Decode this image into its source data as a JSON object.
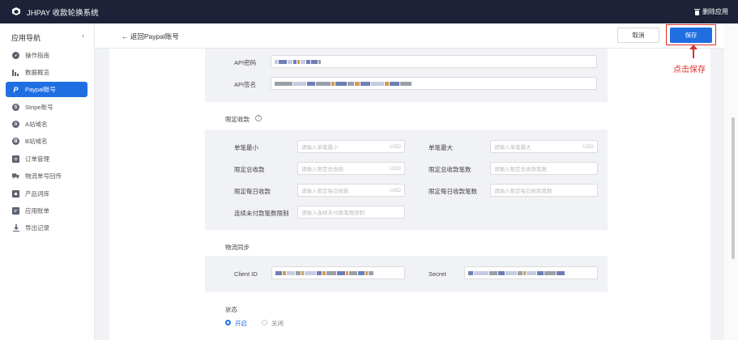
{
  "topbar": {
    "title": "JHPAY 收款轮换系统",
    "delete_app": "删除应用"
  },
  "sidebar": {
    "title": "应用导航",
    "collapse": "‹",
    "items": [
      {
        "label": "操作指南",
        "icon": "compass-icon"
      },
      {
        "label": "数据概览",
        "icon": "bar-chart-icon"
      },
      {
        "label": "Paypal账号",
        "icon": "paypal-icon",
        "active": true
      },
      {
        "label": "Stripe账号",
        "icon": "stripe-icon"
      },
      {
        "label": "A站域名",
        "icon": "a-site-icon"
      },
      {
        "label": "B站域名",
        "icon": "b-site-icon"
      },
      {
        "label": "订单管理",
        "icon": "order-icon"
      },
      {
        "label": "物流单号回传",
        "icon": "truck-icon"
      },
      {
        "label": "产品词库",
        "icon": "book-icon"
      },
      {
        "label": "应用账单",
        "icon": "bill-icon"
      },
      {
        "label": "导出记录",
        "icon": "download-icon"
      }
    ]
  },
  "header": {
    "back": "← 返回Paypal账号",
    "cancel": "取消",
    "save": "保存"
  },
  "annotation": {
    "text": "点击保存",
    "color": "#d9302a"
  },
  "api": {
    "password_label": "API密码",
    "signature_label": "API签名"
  },
  "limits": {
    "section_label": "限定收款",
    "min_label": "单笔最小",
    "min_placeholder": "请输入单笔最小",
    "max_label": "单笔最大",
    "max_placeholder": "请输入单笔最大",
    "total_label": "限定总收款",
    "total_placeholder": "请输入限定总收款",
    "total_count_label": "限定总收款笔数",
    "total_count_placeholder": "请输入限定总收款笔数",
    "daily_label": "限定每日收款",
    "daily_placeholder": "请输入限定每日收款",
    "daily_count_label": "限定每日收款笔数",
    "daily_count_placeholder": "请输入限定每日收款笔数",
    "unpaid_label": "连续未付款笔数限制",
    "unpaid_placeholder": "请输入连续未付款笔数限制",
    "currency": "USD"
  },
  "logistics": {
    "section_label": "物流同步",
    "client_id_label": "Client ID",
    "secret_label": "Secret"
  },
  "status": {
    "label": "状态",
    "on": "开启",
    "off": "关闭",
    "selected": "开启"
  },
  "colors": {
    "primary": "#1f6fe3",
    "topbar": "#1d2238",
    "annotation": "#d9302a"
  }
}
